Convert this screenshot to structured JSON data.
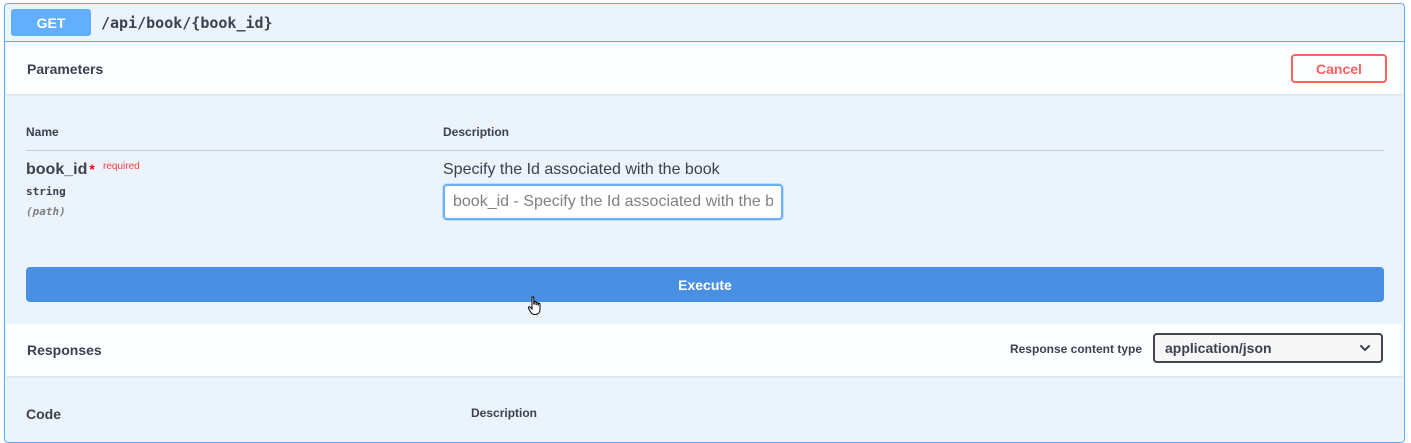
{
  "operation": {
    "method": "GET",
    "path": "/api/book/{book_id}"
  },
  "parameters": {
    "title": "Parameters",
    "cancel_label": "Cancel",
    "col_name": "Name",
    "col_description": "Description",
    "items": [
      {
        "name": "book_id",
        "required_star": "*",
        "required_label": "required",
        "type": "string",
        "in": "(path)",
        "description": "Specify the Id associated with the book",
        "placeholder": "book_id - Specify the Id associated with the book",
        "value": ""
      }
    ]
  },
  "execute_label": "Execute",
  "responses": {
    "title": "Responses",
    "content_type_label": "Response content type",
    "content_type_value": "application/json",
    "col_code": "Code",
    "col_description": "Description"
  },
  "colors": {
    "get_accent": "#61affe",
    "execute": "#4990e2",
    "cancel": "#ff6060"
  },
  "icons": {
    "select": "chevron-down-icon",
    "cursor": "hand-pointer-icon"
  }
}
